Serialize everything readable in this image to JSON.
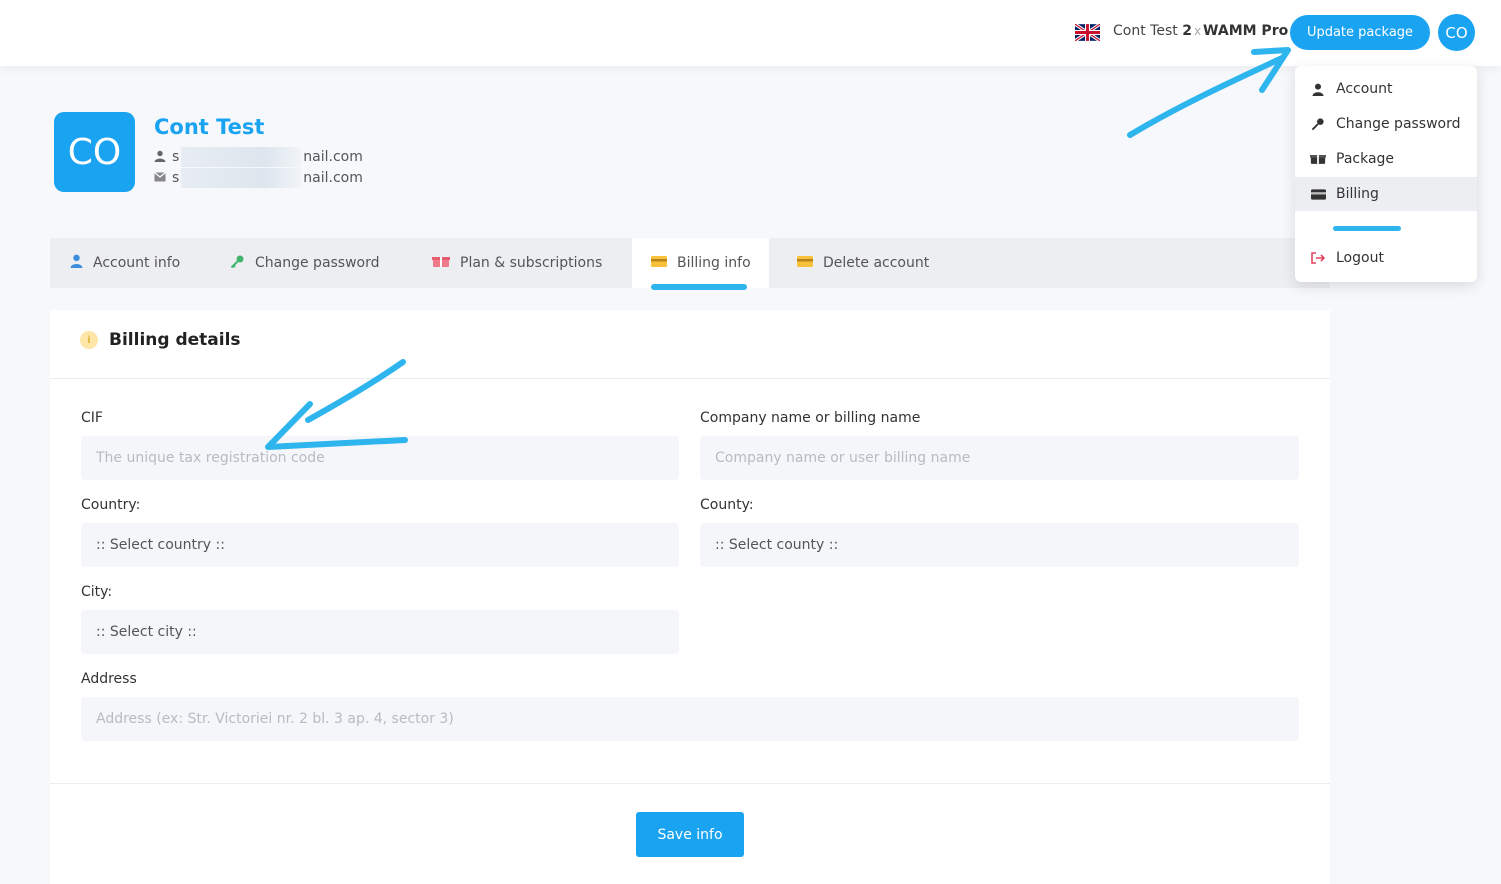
{
  "header": {
    "user_name": "Cont Test",
    "count": "2",
    "times": "x",
    "plan": "WAMM Pro",
    "update_label": "Update package",
    "avatar_initials": "CO",
    "flag_icon": "uk-flag-icon"
  },
  "dropdown": {
    "items": [
      {
        "label": "Account",
        "icon": "user-icon"
      },
      {
        "label": "Change password",
        "icon": "key-icon"
      },
      {
        "label": "Package",
        "icon": "box-icon"
      },
      {
        "label": "Billing",
        "icon": "card-icon"
      },
      {
        "label": "Logout",
        "icon": "logout-icon"
      }
    ],
    "active": "Billing"
  },
  "profile": {
    "initials": "CO",
    "name": "Cont Test",
    "email_prefix": "s",
    "email_suffix": "nail.com",
    "contact_prefix": "s",
    "contact_suffix": "nail.com"
  },
  "tabs": [
    {
      "label": "Account info",
      "icon": "user-icon"
    },
    {
      "label": "Change password",
      "icon": "key-icon"
    },
    {
      "label": "Plan & subscriptions",
      "icon": "gift-icon"
    },
    {
      "label": "Billing info",
      "icon": "card-icon"
    },
    {
      "label": "Delete account",
      "icon": "card-icon"
    }
  ],
  "active_tab": "Billing info",
  "billing": {
    "title": "Billing details",
    "cif_label": "CIF",
    "cif_placeholder": "The unique tax registration code",
    "company_label": "Company name or billing name",
    "company_placeholder": "Company name or user billing name",
    "country_label": "Country:",
    "country_value": ":: Select country ::",
    "county_label": "County:",
    "county_value": ":: Select county ::",
    "city_label": "City:",
    "city_value": ":: Select city ::",
    "address_label": "Address",
    "address_placeholder": "Address (ex: Str. Victoriei nr. 2 bl. 3 ap. 4, sector 3)",
    "save_label": "Save info"
  },
  "colors": {
    "accent": "#1aa3f0",
    "annotation": "#2fb5ee"
  }
}
